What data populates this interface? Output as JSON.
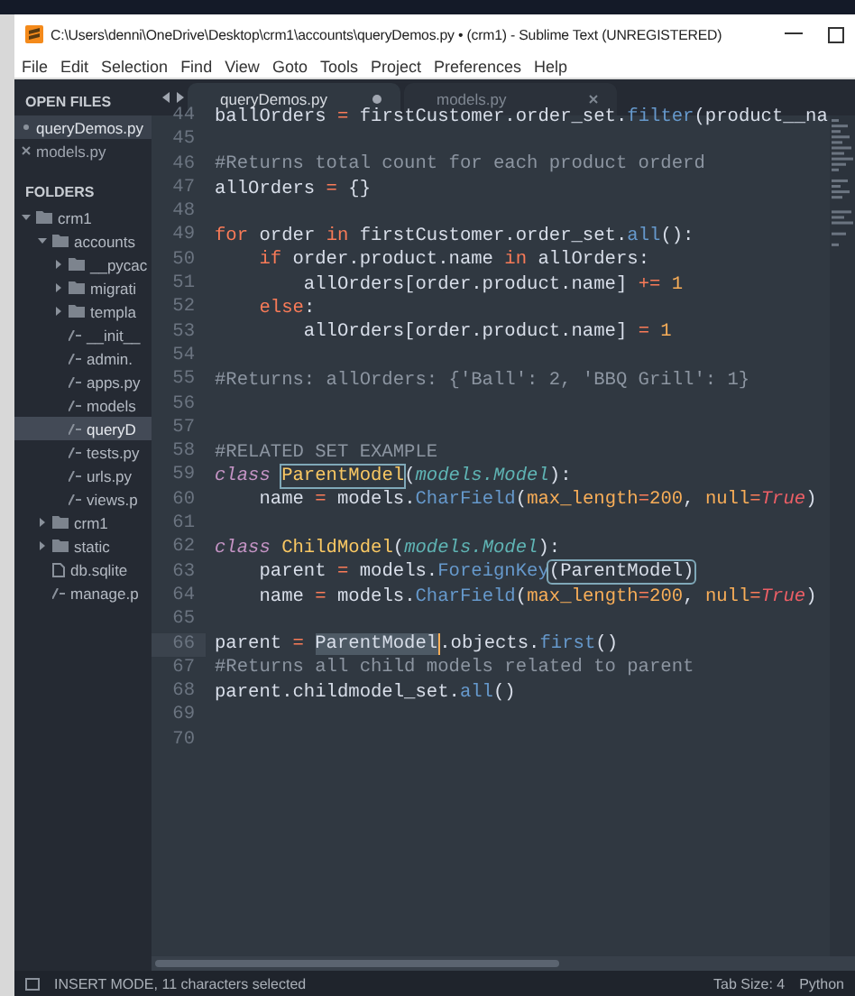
{
  "window": {
    "title": "C:\\Users\\denni\\OneDrive\\Desktop\\crm1\\accounts\\queryDemos.py • (crm1) - Sublime Text (UNREGISTERED)"
  },
  "menu": [
    "File",
    "Edit",
    "Selection",
    "Find",
    "View",
    "Goto",
    "Tools",
    "Project",
    "Preferences",
    "Help"
  ],
  "open_files": {
    "title": "OPEN FILES",
    "items": [
      {
        "label": "queryDemos.py",
        "selected": true
      },
      {
        "label": "models.py",
        "selected": false
      }
    ]
  },
  "folders": {
    "title": "FOLDERS",
    "tree": [
      {
        "label": "crm1",
        "kind": "folder",
        "expanded": true,
        "selected": false,
        "children": [
          {
            "label": "accounts",
            "kind": "folder",
            "expanded": true,
            "selected": false,
            "children": [
              {
                "label": "__pycac",
                "kind": "folder",
                "expanded": false,
                "selected": false
              },
              {
                "label": "migrati",
                "kind": "folder",
                "expanded": false,
                "selected": false
              },
              {
                "label": "templa",
                "kind": "folder",
                "expanded": false,
                "selected": false
              },
              {
                "label": "__init__",
                "kind": "code",
                "selected": false
              },
              {
                "label": "admin.",
                "kind": "code",
                "selected": false
              },
              {
                "label": "apps.py",
                "kind": "code",
                "selected": false
              },
              {
                "label": "models",
                "kind": "code",
                "selected": false
              },
              {
                "label": "queryD",
                "kind": "code",
                "selected": true
              },
              {
                "label": "tests.py",
                "kind": "code",
                "selected": false
              },
              {
                "label": "urls.py",
                "kind": "code",
                "selected": false
              },
              {
                "label": "views.p",
                "kind": "code",
                "selected": false
              }
            ]
          },
          {
            "label": "crm1",
            "kind": "folder",
            "expanded": false,
            "selected": false
          },
          {
            "label": "static",
            "kind": "folder",
            "expanded": false,
            "selected": false
          },
          {
            "label": "db.sqlite",
            "kind": "file",
            "selected": false
          },
          {
            "label": "manage.p",
            "kind": "code",
            "selected": false
          }
        ]
      }
    ]
  },
  "tabs": [
    {
      "label": "queryDemos.py",
      "selected": true,
      "modified": true
    },
    {
      "label": "models.py",
      "selected": false,
      "modified": false
    }
  ],
  "code": {
    "lines": [
      {
        "number": "44",
        "current": false,
        "tokens": [
          {
            "kind": "plain",
            "text": "ballOrders "
          },
          {
            "kind": "keyword",
            "text": "="
          },
          {
            "kind": "plain",
            "text": " firstCustomer.order_set."
          },
          {
            "kind": "function",
            "text": "filter"
          },
          {
            "kind": "plain",
            "text": "(product__na"
          }
        ]
      },
      {
        "number": "45",
        "current": false
      },
      {
        "number": "46",
        "current": false,
        "tokens": [
          {
            "kind": "comment",
            "text": "#Returns total count for each product orderd"
          }
        ]
      },
      {
        "number": "47",
        "current": false,
        "tokens": [
          {
            "kind": "plain",
            "text": "allOrders "
          },
          {
            "kind": "keyword",
            "text": "="
          },
          {
            "kind": "plain",
            "text": " {}"
          }
        ]
      },
      {
        "number": "48",
        "current": false
      },
      {
        "number": "49",
        "current": false,
        "tokens": [
          {
            "kind": "keyword",
            "text": "for"
          },
          {
            "kind": "plain",
            "text": " order "
          },
          {
            "kind": "keyword",
            "text": "in"
          },
          {
            "kind": "plain",
            "text": " firstCustomer.order_set."
          },
          {
            "kind": "function",
            "text": "all"
          },
          {
            "kind": "plain",
            "text": "():"
          }
        ]
      },
      {
        "number": "50",
        "current": false,
        "tokens": [
          {
            "kind": "keyword",
            "text": "    if"
          },
          {
            "kind": "plain",
            "text": " order.product.name "
          },
          {
            "kind": "keyword",
            "text": "in"
          },
          {
            "kind": "plain",
            "text": " allOrders:"
          }
        ]
      },
      {
        "number": "51",
        "current": false,
        "tokens": [
          {
            "kind": "plain",
            "text": "        allOrders[order.product.name] "
          },
          {
            "kind": "keyword",
            "text": "+= "
          },
          {
            "kind": "number",
            "text": "1"
          }
        ]
      },
      {
        "number": "52",
        "current": false,
        "tokens": [
          {
            "kind": "keyword",
            "text": "    else"
          },
          {
            "kind": "plain",
            "text": ":"
          }
        ]
      },
      {
        "number": "53",
        "current": false,
        "tokens": [
          {
            "kind": "plain",
            "text": "        allOrders[order.product.name] "
          },
          {
            "kind": "keyword",
            "text": "= "
          },
          {
            "kind": "number",
            "text": "1"
          }
        ]
      },
      {
        "number": "54",
        "current": false
      },
      {
        "number": "55",
        "current": false,
        "tokens": [
          {
            "kind": "comment",
            "text": "#Returns: allOrders: {'Ball': 2, 'BBQ Grill': 1}"
          }
        ]
      },
      {
        "number": "56",
        "current": false
      },
      {
        "number": "57",
        "current": false
      },
      {
        "number": "58",
        "current": false,
        "tokens": [
          {
            "kind": "comment",
            "text": "#RELATED SET EXAMPLE"
          }
        ]
      },
      {
        "number": "59",
        "current": false,
        "tokens": [
          {
            "kind": "storage",
            "text": "class "
          },
          {
            "kind": "match",
            "text": "ParentModel"
          },
          {
            "kind": "plain",
            "text": "("
          },
          {
            "kind": "base",
            "text": "models.Model"
          },
          {
            "kind": "plain",
            "text": "):"
          }
        ]
      },
      {
        "number": "60",
        "current": false,
        "tokens": [
          {
            "kind": "plain",
            "text": "    name "
          },
          {
            "kind": "keyword",
            "text": "="
          },
          {
            "kind": "plain",
            "text": " models."
          },
          {
            "kind": "function",
            "text": "CharField"
          },
          {
            "kind": "plain",
            "text": "("
          },
          {
            "kind": "argument",
            "text": "max_length"
          },
          {
            "kind": "keyword",
            "text": "="
          },
          {
            "kind": "number",
            "text": "200"
          },
          {
            "kind": "plain",
            "text": ", "
          },
          {
            "kind": "argument",
            "text": "null"
          },
          {
            "kind": "keyword",
            "text": "="
          },
          {
            "kind": "constant",
            "text": "True"
          },
          {
            "kind": "plain",
            "text": ")"
          }
        ]
      },
      {
        "number": "61",
        "current": false
      },
      {
        "number": "62",
        "current": false,
        "tokens": [
          {
            "kind": "storage",
            "text": "class "
          },
          {
            "kind": "class",
            "text": "ChildModel"
          },
          {
            "kind": "plain",
            "text": "("
          },
          {
            "kind": "base",
            "text": "models.Model"
          },
          {
            "kind": "plain",
            "text": "):"
          }
        ]
      },
      {
        "number": "63",
        "current": false,
        "tokens": [
          {
            "kind": "plain",
            "text": "    parent "
          },
          {
            "kind": "keyword",
            "text": "="
          },
          {
            "kind": "plain",
            "text": " models."
          },
          {
            "kind": "function",
            "text": "ForeignKey"
          },
          {
            "kind": "bracket_match",
            "text": "(ParentModel)"
          }
        ]
      },
      {
        "number": "64",
        "current": false,
        "tokens": [
          {
            "kind": "plain",
            "text": "    name "
          },
          {
            "kind": "keyword",
            "text": "="
          },
          {
            "kind": "plain",
            "text": " models."
          },
          {
            "kind": "function",
            "text": "CharField"
          },
          {
            "kind": "plain",
            "text": "("
          },
          {
            "kind": "argument",
            "text": "max_length"
          },
          {
            "kind": "keyword",
            "text": "="
          },
          {
            "kind": "number",
            "text": "200"
          },
          {
            "kind": "plain",
            "text": ", "
          },
          {
            "kind": "argument",
            "text": "null"
          },
          {
            "kind": "keyword",
            "text": "="
          },
          {
            "kind": "constant",
            "text": "True"
          },
          {
            "kind": "plain",
            "text": ")"
          }
        ]
      },
      {
        "number": "65",
        "current": false
      },
      {
        "number": "66",
        "current": true,
        "tokens": [
          {
            "kind": "plain",
            "text": "parent "
          },
          {
            "kind": "keyword",
            "text": "= "
          },
          {
            "kind": "selection",
            "text": "ParentModel"
          },
          {
            "kind": "plain",
            "text": ".objects."
          },
          {
            "kind": "function",
            "text": "first"
          },
          {
            "kind": "plain",
            "text": "()"
          }
        ]
      },
      {
        "number": "67",
        "current": false,
        "tokens": [
          {
            "kind": "comment",
            "text": "#Returns all child models related to parent"
          }
        ]
      },
      {
        "number": "68",
        "current": false,
        "tokens": [
          {
            "kind": "plain",
            "text": "parent.childmodel_set."
          },
          {
            "kind": "function",
            "text": "all"
          },
          {
            "kind": "plain",
            "text": "()"
          }
        ]
      },
      {
        "number": "69",
        "current": false
      },
      {
        "number": "70",
        "current": false
      }
    ]
  },
  "status_bar": {
    "left": "INSERT MODE, 11 characters selected",
    "tab_size": "Tab Size: 4",
    "syntax": "Python"
  }
}
